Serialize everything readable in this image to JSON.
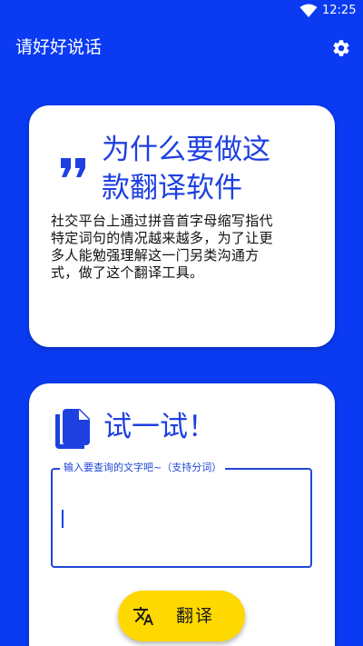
{
  "status_bar": {
    "time": "12:25"
  },
  "app_bar": {
    "title": "请好好说话"
  },
  "why_card": {
    "title_line1": "为什么要做这",
    "title_line2": "款翻译软件",
    "body_line1": "社交平台上通过拼音首字母缩写指代",
    "body_line2": "特定词句的情况越来越多，为了让更",
    "body_line3": "多人能勉强理解这一门另类沟通方",
    "body_line4": "式，做了这个翻译工具。"
  },
  "try_card": {
    "title": "试一试！",
    "input": {
      "label": "输入要查询的文字吧~（支持分词）",
      "value": ""
    },
    "translate_button": "翻译"
  },
  "colors": {
    "primary": "#0a3bf2",
    "accent_text": "#1e40e0",
    "button": "#ffd800",
    "card": "#ffffff"
  }
}
